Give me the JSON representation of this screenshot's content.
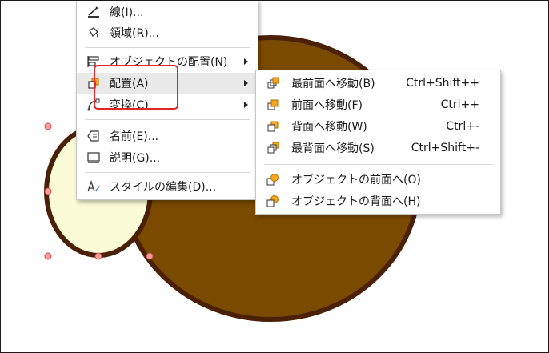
{
  "context_menu": {
    "items": [
      {
        "label": "線(I)...",
        "icon": "line-icon"
      },
      {
        "label": "領域(R)...",
        "icon": "area-fill-icon"
      },
      {
        "label": "オブジェクトの配置(N)",
        "icon": "object-position-icon",
        "submenu": true
      },
      {
        "label": "配置(A)",
        "icon": "arrange-icon",
        "submenu": true,
        "highlighted": true
      },
      {
        "label": "変換(C)",
        "icon": "convert-icon",
        "submenu": true
      },
      {
        "label": "名前(E)...",
        "icon": "name-tag-icon"
      },
      {
        "label": "説明(G)...",
        "icon": "description-icon"
      },
      {
        "label": "スタイルの編集(D)...",
        "icon": "edit-style-icon"
      }
    ]
  },
  "arrange_submenu": {
    "items": [
      {
        "label": "最前面へ移動(B)",
        "shortcut": "Ctrl+Shift++",
        "icon": "bring-to-front-icon"
      },
      {
        "label": "前面へ移動(F)",
        "shortcut": "Ctrl++",
        "icon": "bring-forward-icon"
      },
      {
        "label": "背面へ移動(W)",
        "shortcut": "Ctrl+-",
        "icon": "send-backward-icon"
      },
      {
        "label": "最背面へ移動(S)",
        "shortcut": "Ctrl+Shift+-",
        "icon": "send-to-back-icon"
      },
      {
        "label": "オブジェクトの前面へ(O)",
        "icon": "in-front-of-object-icon"
      },
      {
        "label": "オブジェクトの背面へ(H)",
        "icon": "behind-object-icon"
      }
    ]
  },
  "colors": {
    "large_ellipse_fill": "#7a4a00",
    "ellipse_outline": "#4a2108",
    "small_ellipse_fill": "#fbfbd8",
    "selection_handle": "#ff9a9a",
    "icon_accent": "#f5a623",
    "annotation_box": "#e0262a"
  }
}
